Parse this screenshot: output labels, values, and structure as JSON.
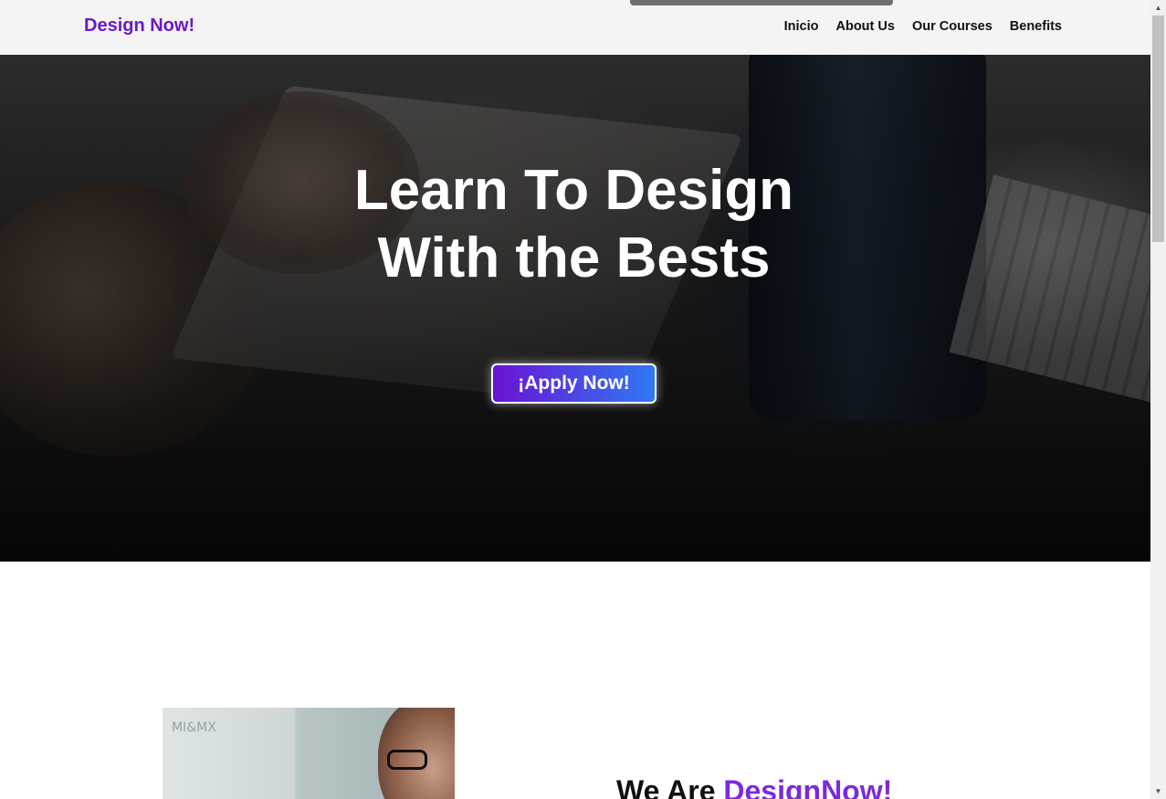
{
  "navbar": {
    "brand": "Design Now!",
    "links": [
      "Inicio",
      "About Us",
      "Our Courses",
      "Benefits"
    ]
  },
  "hero": {
    "title_line1": "Learn To Design",
    "title_line2": "With the Bests",
    "cta_label": "¡Apply Now!"
  },
  "about": {
    "title_prefix": "We Are ",
    "title_accent": "DesignNow!",
    "image_brand_text": "MI&MX"
  },
  "colors": {
    "brand": "#6b18c9",
    "accent": "#7b2ae0",
    "cta_gradient_start": "#6a13d2",
    "cta_gradient_end": "#2f78f5"
  },
  "scrollbar": {
    "up_icon": "chevron-up-icon",
    "down_icon": "chevron-down-icon"
  }
}
